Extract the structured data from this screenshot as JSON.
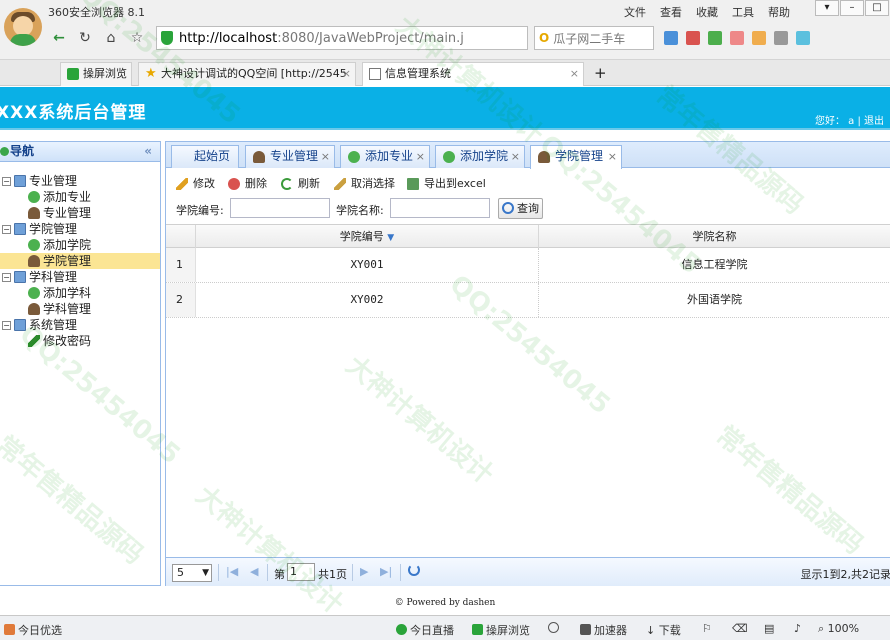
{
  "browser": {
    "app_title": "360安全浏览器 8.1",
    "menu": [
      "文件",
      "查看",
      "收藏",
      "工具",
      "帮助"
    ],
    "url_host": "http://localhost",
    "url_rest": ":8080/JavaWebProject/main.j",
    "search_placeholder": "瓜子网二手车",
    "tabs": [
      {
        "label": "操屏浏览"
      },
      {
        "label": "大神设计调试的QQ空间 [http://2545"
      },
      {
        "label": "信息管理系统"
      }
    ],
    "new_tab": "+"
  },
  "app": {
    "title": "XXX系统后台管理",
    "user_text": "您好： a  |  退出"
  },
  "nav": {
    "title": "导航",
    "collapse": "«",
    "tree": [
      {
        "label": "专业管理",
        "type": "folder"
      },
      {
        "label": "添加专业",
        "type": "add"
      },
      {
        "label": "专业管理",
        "type": "person"
      },
      {
        "label": "学院管理",
        "type": "folder"
      },
      {
        "label": "添加学院",
        "type": "add"
      },
      {
        "label": "学院管理",
        "type": "person",
        "selected": true
      },
      {
        "label": "学科管理",
        "type": "folder"
      },
      {
        "label": "添加学科",
        "type": "add"
      },
      {
        "label": "学科管理",
        "type": "person"
      },
      {
        "label": "系统管理",
        "type": "folder"
      },
      {
        "label": "修改密码",
        "type": "pencil"
      }
    ]
  },
  "main_tabs": [
    {
      "label": "起始页"
    },
    {
      "label": "专业管理"
    },
    {
      "label": "添加专业"
    },
    {
      "label": "添加学院"
    },
    {
      "label": "学院管理",
      "active": true
    }
  ],
  "toolbar": {
    "edit": "修改",
    "delete": "删除",
    "refresh": "刷新",
    "deselect": "取消选择",
    "export": "导出到excel",
    "code_label": "学院编号:",
    "name_label": "学院名称:",
    "query": "查询"
  },
  "grid": {
    "columns": [
      "学院编号",
      "学院名称"
    ],
    "rows": [
      {
        "num": "1",
        "code": "XY001",
        "name": "信息工程学院"
      },
      {
        "num": "2",
        "code": "XY002",
        "name": "外国语学院"
      }
    ]
  },
  "pager": {
    "page_size": "5",
    "page_prefix": "第",
    "page": "1",
    "page_total": "共1页",
    "info": "显示1到2,共2记录"
  },
  "footer": {
    "text": "© Powered by dashen"
  },
  "status_bar": {
    "left": "今日优选",
    "live": "今日直播",
    "screen": "操屏浏览",
    "accel": "加速器",
    "download": "下载",
    "zoom": "100%"
  },
  "watermark": [
    "QQ:25454045",
    "大神计算机设计",
    "QQ:25454045",
    "常年售精品源码",
    "大神计算机设计",
    "QQ:25454045",
    "常年售精品源码",
    "QQ:25454045",
    "大神计算机设计",
    "常年售精品源码"
  ]
}
